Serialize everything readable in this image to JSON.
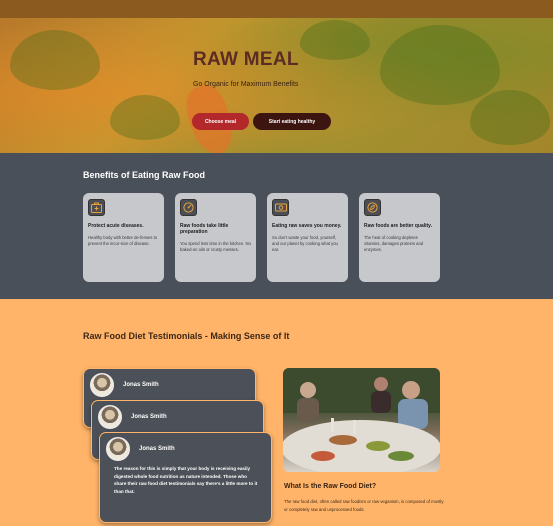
{
  "hero": {
    "title": "RAW MEAL",
    "subtitle": "Go Organic for Maximum Benefits",
    "choose_button": "Choose meal",
    "start_button": "Start eating healthy"
  },
  "benefits": {
    "title": "Benefits of Eating Raw Food",
    "cards": [
      {
        "icon": "first-aid-icon",
        "title": "Protect acute diseases.",
        "text": "Healthy body with better de-fenses to prevent the incur-sion of disease."
      },
      {
        "icon": "gauge-icon",
        "title": "Raw foods take little preparation",
        "text": "You spend less time in the kitchen. No baked-on oils or crusty messes."
      },
      {
        "icon": "money-icon",
        "title": "Eating raw saves you money.",
        "text": "So don't waste your food, yourself, and our planet by cooking what you eat."
      },
      {
        "icon": "leaf-icon",
        "title": "Raw foods are better quality.",
        "text": "The heat of cooking depletes vitamins, damages proteins and enzymes."
      }
    ]
  },
  "testimonials": {
    "title": "Raw Food Diet Testimonials - Making Sense of It",
    "cards": [
      {
        "name": "Jonas Smith"
      },
      {
        "name": "Jonas Smith"
      },
      {
        "name": "Jonas Smith",
        "quote": "The reason for this is simply that your body is receiving easily digested whole food nutrition as nature intended. Those who share their raw food diet testimonials say there's a little more to it than that."
      }
    ],
    "aside_title": "What Is the Raw Food Diet?",
    "aside_text": "The raw food diet, often called raw foodism or raw veganism, is composed of mostly or completely raw and unprocessed foods."
  }
}
